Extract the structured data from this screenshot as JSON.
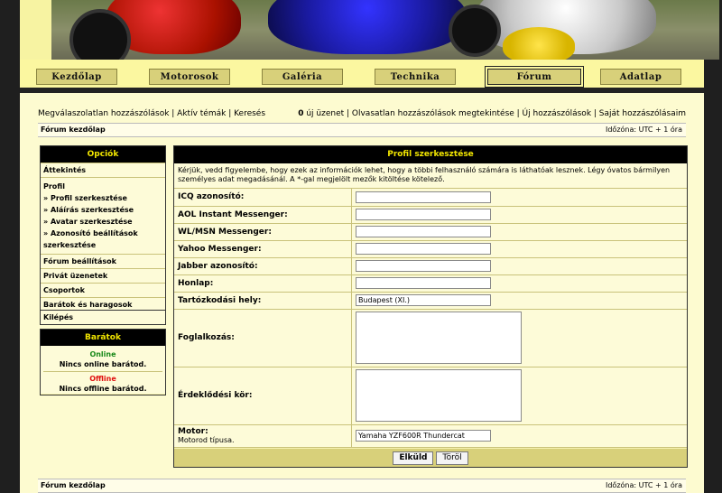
{
  "nav": {
    "items": [
      "Kezdőlap",
      "Motorosok",
      "Galéria",
      "Technika",
      "Fórum",
      "Adatlap"
    ],
    "active": "Fórum"
  },
  "topline": {
    "left": "Megválaszolatlan hozzászólások | Aktív témák | Keresés",
    "new_count": "0",
    "right": " új üzenet | Olvasatlan hozzászólások megtekintése | Új hozzászólások | Saját hozzászólásaim"
  },
  "breadcrumb": {
    "label": "Fórum kezdőlap",
    "timezone": "Időzóna: UTC + 1 óra"
  },
  "sidebar": {
    "title": "Opciók",
    "overview": "Áttekintés",
    "profile": "Profil",
    "profile_items": [
      "» Profil szerkesztése",
      "» Aláírás szerkesztése",
      "» Avatar szerkesztése",
      "» Azonosító beállítások szerkesztése"
    ],
    "items": [
      "Fórum beállítások",
      "Privát üzenetek",
      "Csoportok",
      "Barátok és haragosok"
    ],
    "logout": "Kilépés"
  },
  "friends": {
    "title": "Barátok",
    "online_label": "Online",
    "online_text": "Nincs online barátod.",
    "offline_label": "Offline",
    "offline_text": "Nincs offline barátod.",
    "online_color": "#1a8a1a",
    "offline_color": "#e01010"
  },
  "panel": {
    "title": "Profil szerkesztése",
    "note": "Kérjük, vedd figyelembe, hogy ezek az információk lehet, hogy a többi felhasználó számára is láthatóak lesznek. Légy óvatos bármilyen személyes adat megadásánál. A *-gal megjelölt mezők kitöltése kötelező.",
    "fields": {
      "icq": {
        "label": "ICQ azonosító:",
        "value": ""
      },
      "aol": {
        "label": "AOL Instant Messenger:",
        "value": ""
      },
      "wlm": {
        "label": "WL/MSN Messenger:",
        "value": ""
      },
      "yahoo": {
        "label": "Yahoo Messenger:",
        "value": ""
      },
      "jabber": {
        "label": "Jabber azonosító:",
        "value": ""
      },
      "website": {
        "label": "Honlap:",
        "value": ""
      },
      "location": {
        "label": "Tartózkodási hely:",
        "value": "Budapest (XI.)"
      },
      "occupation": {
        "label": "Foglalkozás:",
        "value": ""
      },
      "interests": {
        "label": "Érdeklődési kör:",
        "value": ""
      },
      "motor": {
        "label": "Motor:",
        "sublabel": "Motorod típusa.",
        "value": "Yamaha YZF600R Thundercat"
      }
    },
    "submit": "Elküld",
    "reset": "Töröl"
  },
  "footer": {
    "label": "Fórum kezdőlap",
    "timezone": "Időzóna: UTC + 1 óra"
  },
  "colors": {
    "accent": "#f2e600",
    "bg": "#fdfbd0",
    "nav": "#d8d07a"
  }
}
